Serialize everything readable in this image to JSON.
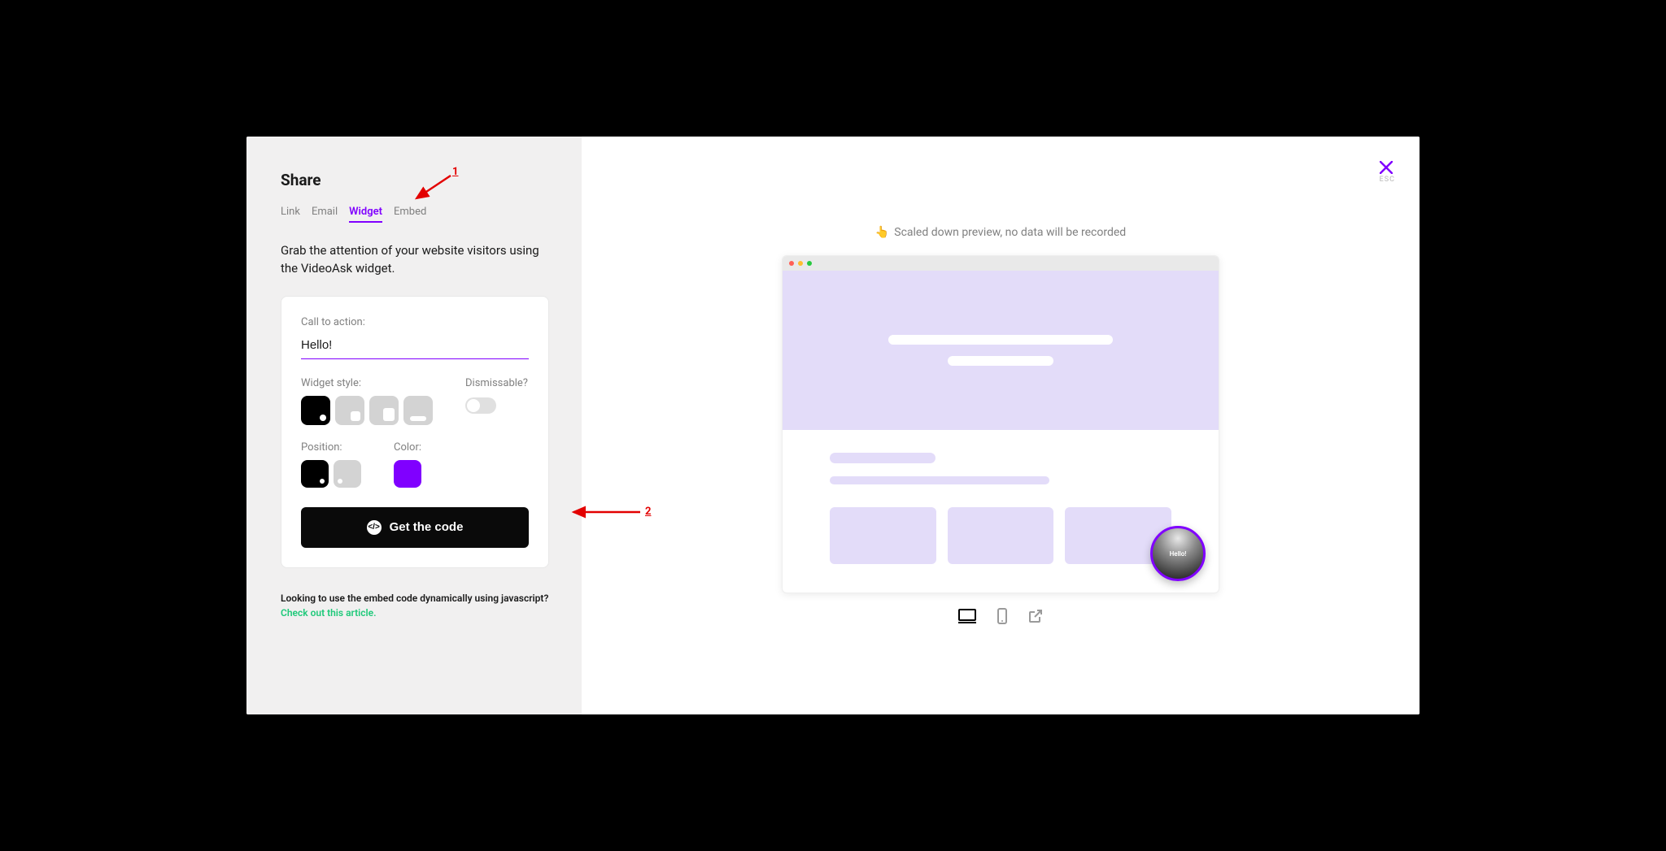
{
  "header": {
    "title": "Share"
  },
  "tabs": [
    "Link",
    "Email",
    "Widget",
    "Embed"
  ],
  "activeTab": "Widget",
  "intro": "Grab the attention of your website visitors using the VideoAsk widget.",
  "card": {
    "ctaLabel": "Call to action:",
    "ctaValue": "Hello!",
    "widgetStyleLabel": "Widget style:",
    "dismissableLabel": "Dismissable?",
    "positionLabel": "Position:",
    "colorLabel": "Color:",
    "colorValue": "#8000ff",
    "getCodeLabel": "Get the code"
  },
  "footnote": {
    "prefix": "Looking to use the embed code dynamically using javascript?",
    "linkText": "Check out this article."
  },
  "close": {
    "escLabel": "ESC"
  },
  "preview": {
    "caption": "Scaled down preview, no data will be recorded",
    "bubbleText": "Hello!"
  },
  "annotations": {
    "one": "1",
    "two": "2"
  }
}
